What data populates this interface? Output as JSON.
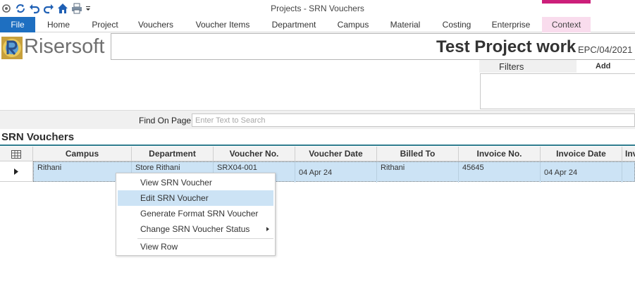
{
  "window": {
    "title": "Projects - SRN Vouchers"
  },
  "quick_access": {
    "icons": [
      "gear-icon",
      "refresh-icon",
      "undo-icon",
      "redo-icon",
      "home-icon",
      "print-icon",
      "dropdown-caret-icon"
    ]
  },
  "ribbon": {
    "tabs": [
      {
        "label": "File"
      },
      {
        "label": "Home"
      },
      {
        "label": "Project"
      },
      {
        "label": "Vouchers"
      },
      {
        "label": "Voucher Items"
      },
      {
        "label": "Department"
      },
      {
        "label": "Campus"
      },
      {
        "label": "Material"
      },
      {
        "label": "Costing"
      },
      {
        "label": "Enterprise"
      },
      {
        "label": "Context"
      }
    ],
    "file_color": "#1e6fc1",
    "context_color": "#f9dced",
    "context_accent": "#cc1f7a"
  },
  "branding": {
    "logo_text": "Risersoft"
  },
  "project": {
    "title": "Test Project work",
    "code": "EPC/04/2021"
  },
  "filters": {
    "label": "Filters",
    "add_label": "Add"
  },
  "find": {
    "label": "Find On Page",
    "placeholder": "Enter Text to Search",
    "value": ""
  },
  "section": {
    "title": "SRN Vouchers",
    "accent": "#2f7d8e"
  },
  "grid": {
    "columns": [
      {
        "label": "Campus"
      },
      {
        "label": "Department"
      },
      {
        "label": "Voucher No."
      },
      {
        "label": "Voucher Date"
      },
      {
        "label": "Billed To"
      },
      {
        "label": "Invoice No."
      },
      {
        "label": "Invoice Date"
      },
      {
        "label": "Inv"
      }
    ],
    "rows": [
      {
        "campus": "Rithani",
        "department": "Store Rithani",
        "voucher_no": "SRX04-001",
        "voucher_date": "04 Apr 24",
        "billed_to": "Rithani",
        "invoice_no": "45645",
        "invoice_date": "04 Apr 24",
        "inv": ""
      }
    ],
    "selected_row_color": "#cce3f5"
  },
  "context_menu": {
    "items": [
      {
        "label": "View SRN Voucher"
      },
      {
        "label": "Edit SRN Voucher"
      },
      {
        "label": "Generate Format SRN Voucher"
      },
      {
        "label": "Change SRN Voucher Status"
      },
      {
        "label": "View Row"
      }
    ],
    "highlighted_index": 1
  }
}
